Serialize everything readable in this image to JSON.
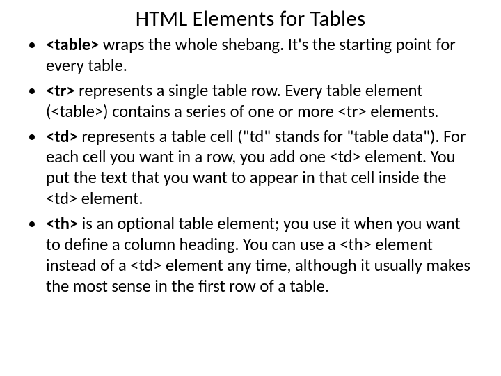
{
  "title": "HTML Elements for Tables",
  "bullets": [
    {
      "tag": "<table>",
      "text": " wraps the whole shebang. It's the starting point for every table."
    },
    {
      "tag": "<tr>",
      "text": " represents a single table row. Every table element (<table>) contains a series of one or more <tr> elements."
    },
    {
      "tag": "<td>",
      "text": " represents a table cell (\"td\" stands for \"table data\"). For each cell you want in a row, you add one <td> element. You put the text that you want to appear in that cell inside the <td> element."
    },
    {
      "tag": "<th>",
      "text": " is an optional table element; you use it when you want to define a column heading. You can use a <th> element instead of a <td> element any time, although it usually makes the most sense in the first row of a table."
    }
  ]
}
